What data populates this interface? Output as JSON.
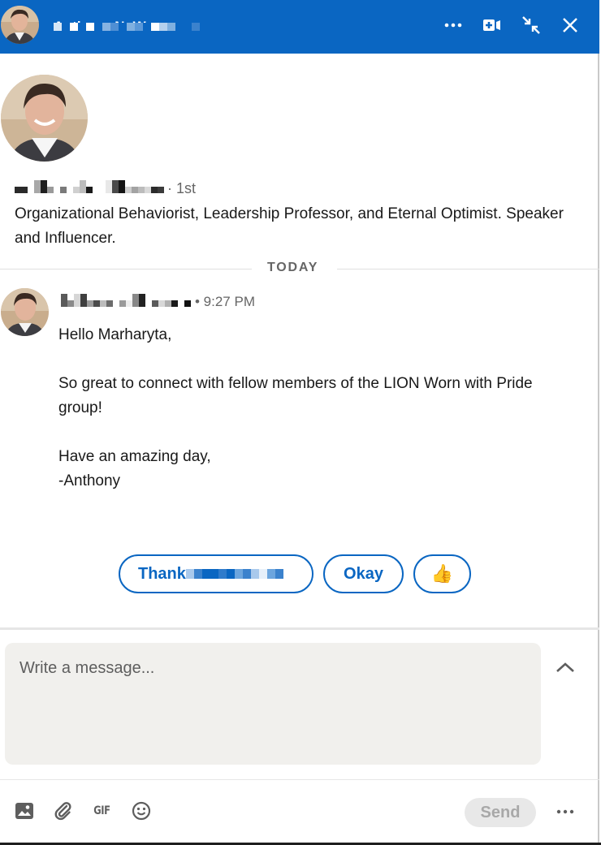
{
  "header": {
    "title": "Anthony N. Warren",
    "icons": {
      "more": "more-horizontal-icon",
      "video": "video-call-icon",
      "minimize": "collapse-arrows-icon",
      "close": "close-icon"
    },
    "colors": {
      "background": "#0a66c2",
      "foreground": "#ffffff"
    }
  },
  "profile": {
    "name_obscured": true,
    "degree": "· 1st",
    "headline": "Organizational Behaviorist, Leadership Professor, and Eternal Optimist. Speaker and Influencer."
  },
  "divider": {
    "label": "TODAY"
  },
  "message": {
    "sender_obscured": true,
    "time": "• 9:27 PM",
    "lines": [
      "Hello Marharyta,",
      "",
      "So great to connect with fellow members of the LION Worn with Pride group!",
      "",
      "Have an amazing day,",
      "-Anthony"
    ]
  },
  "quick_replies": [
    {
      "label": "Thank",
      "obscured_suffix": true
    },
    {
      "label": "Okay"
    },
    {
      "label": "👍"
    }
  ],
  "composer": {
    "placeholder": "Write a message...",
    "value": "",
    "send_label": "Send",
    "tools": [
      "image-icon",
      "paperclip-icon",
      "gif-icon",
      "emoji-icon"
    ],
    "gif_label": "GIF"
  },
  "colors": {
    "accent": "#0a66c2",
    "composer_bg": "#f1f0ed",
    "muted_text": "#666666"
  }
}
